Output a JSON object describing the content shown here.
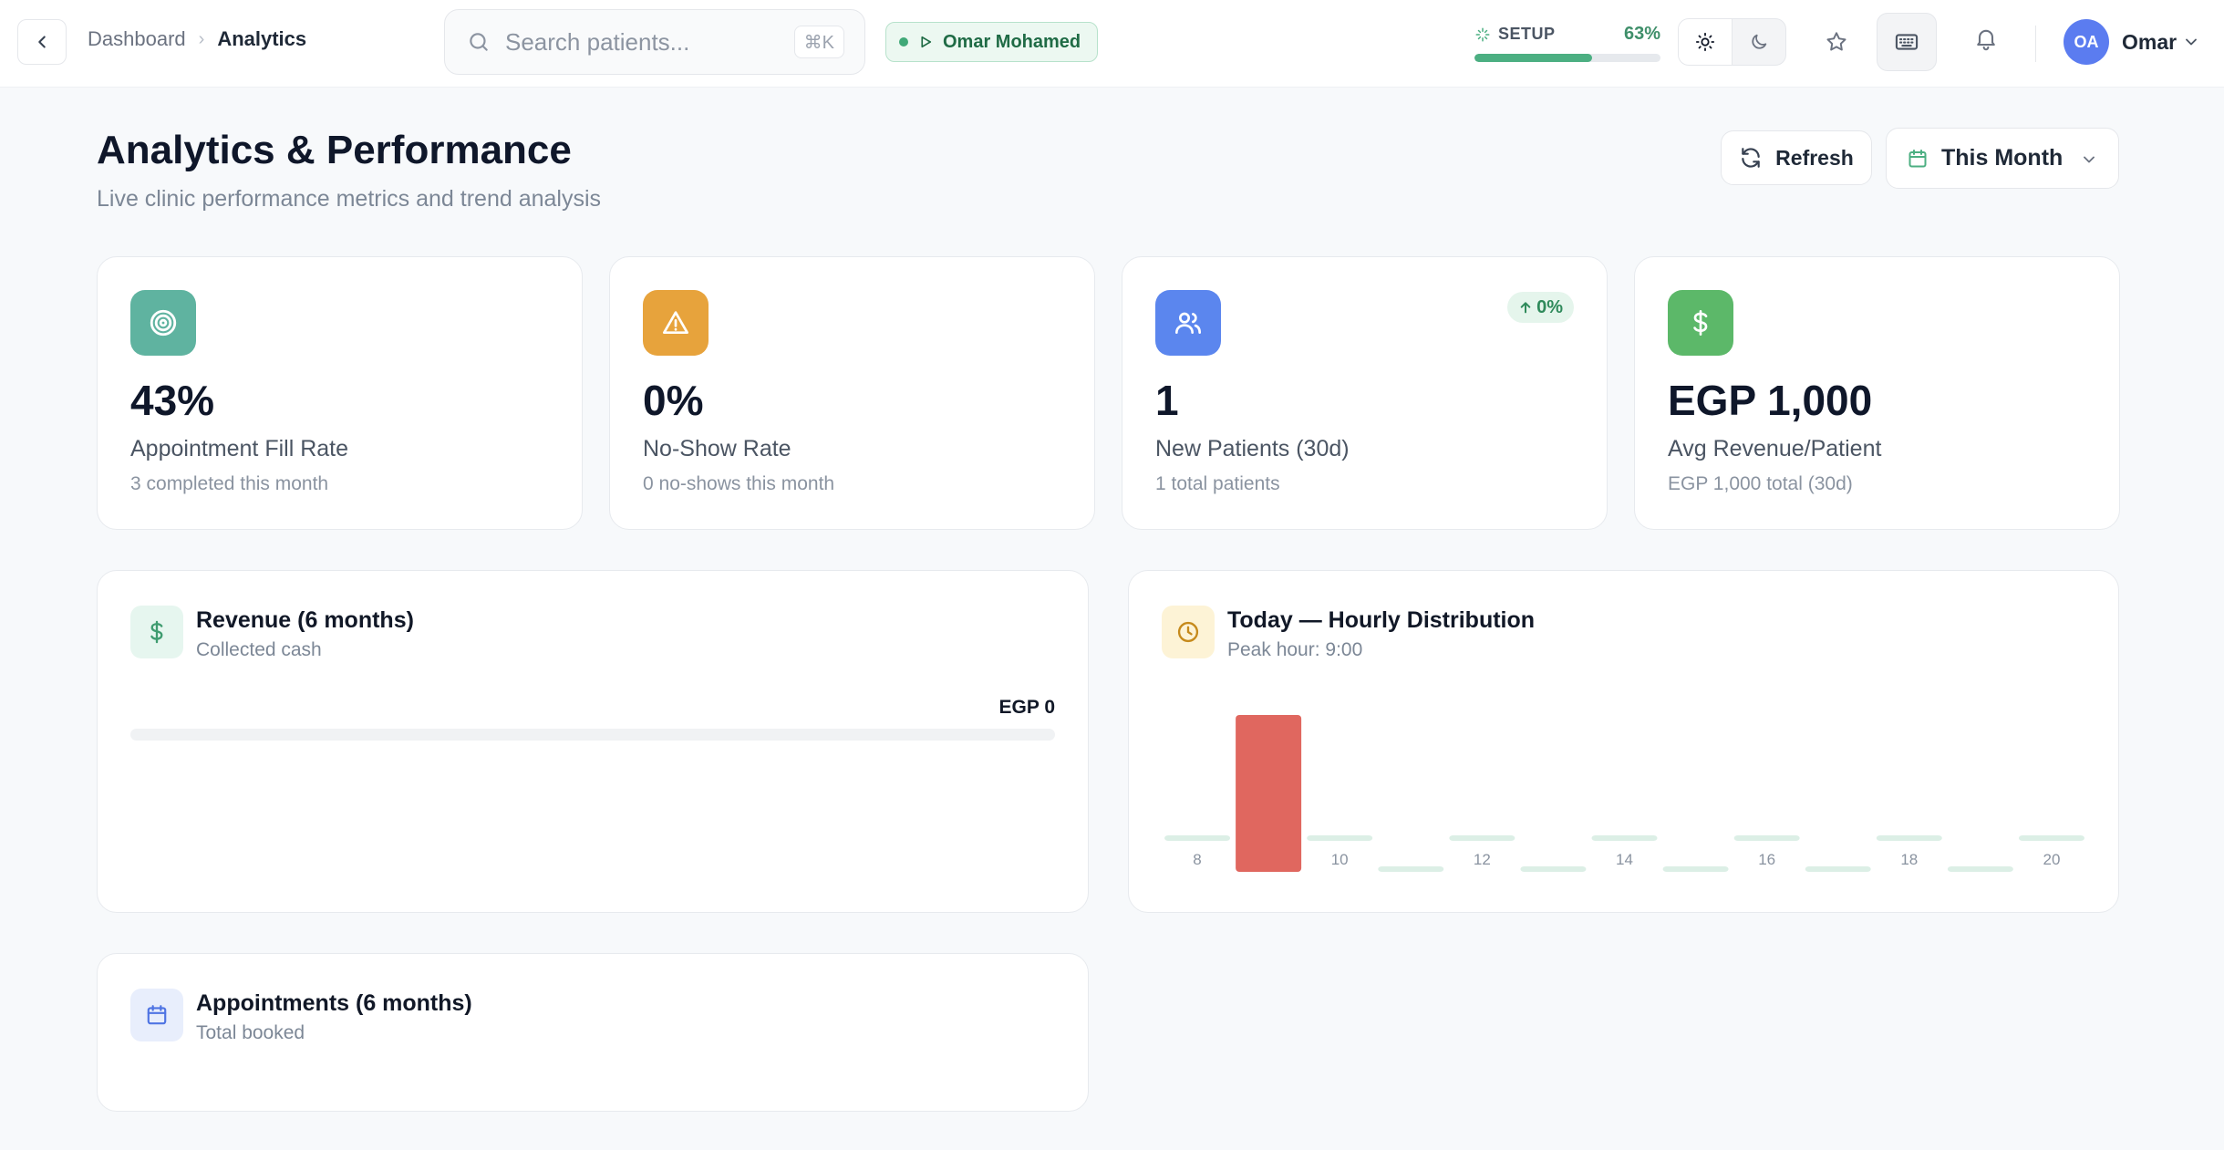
{
  "breadcrumb": {
    "items": [
      "Dashboard",
      "Analytics"
    ]
  },
  "search": {
    "placeholder": "Search patients...",
    "shortcut": "⌘K"
  },
  "session": {
    "name": "Omar Mohamed",
    "status_color": "#3fa877"
  },
  "setup": {
    "label": "SETUP",
    "percent_text": "63%",
    "progress": 0.63
  },
  "theme": {
    "modes": [
      "light",
      "dark"
    ],
    "active": "light"
  },
  "user": {
    "initials": "OA",
    "name": "Omar"
  },
  "header": {
    "title": "Analytics & Performance",
    "subtitle": "Live clinic performance metrics and trend analysis",
    "refresh_label": "Refresh",
    "period_label": "This Month"
  },
  "kpis": [
    {
      "icon": "target-icon",
      "color": "#5fb3a0",
      "value": "43%",
      "label": "Appointment Fill Rate",
      "note": "3 completed this month"
    },
    {
      "icon": "warning-icon",
      "color": "#e7a33c",
      "value": "0%",
      "label": "No-Show Rate",
      "note": "0 no-shows this month"
    },
    {
      "icon": "users-icon",
      "color": "#5b86ee",
      "value": "1",
      "label": "New Patients (30d)",
      "note": "1 total patients",
      "trend": "0%"
    },
    {
      "icon": "dollar-icon",
      "color": "#5cb869",
      "value": "EGP 1,000",
      "label": "Avg Revenue/Patient",
      "note": "EGP 1,000 total (30d)"
    }
  ],
  "revenue": {
    "title": "Revenue (6 months)",
    "subtitle": "Collected cash",
    "amount": "EGP 0",
    "progress": 0
  },
  "hourly": {
    "title": "Today — Hourly Distribution",
    "subtitle": "Peak hour: 9:00",
    "peak_color": "#e0675f",
    "base_color": "#dcefe6"
  },
  "appointments": {
    "title": "Appointments (6 months)",
    "subtitle": "Total booked"
  },
  "chart_data": {
    "type": "bar",
    "categories": [
      "8",
      "9",
      "10",
      "11",
      "12",
      "13",
      "14",
      "15",
      "16",
      "17",
      "18",
      "19",
      "20"
    ],
    "values": [
      0,
      1,
      0,
      0,
      0,
      0,
      0,
      0,
      0,
      0,
      0,
      0,
      0
    ],
    "tick_labels": [
      "8",
      "",
      "10",
      "",
      "12",
      "",
      "14",
      "",
      "16",
      "",
      "18",
      "",
      "20"
    ],
    "title": "Today — Hourly Distribution",
    "xlabel": "",
    "ylabel": "",
    "grid": false
  }
}
